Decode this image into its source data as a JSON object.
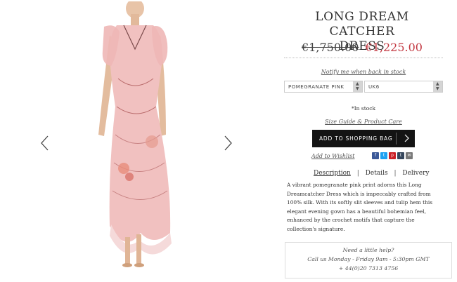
{
  "gallery": {
    "prev_icon": "chevron-left-icon",
    "next_icon": "chevron-right-icon"
  },
  "product": {
    "title_line1": "LONG DREAM CATCHER",
    "title_line2": "DRESS",
    "price_old": "€1,750.00",
    "price_new": "€1,225.00",
    "price_new_color": "#c33a43",
    "notify": "Notify me when back in stock",
    "color_select": "POMEGRANATE PINK",
    "size_select": "UK6",
    "stock": "*In stock",
    "size_guide": "Size Guide & Product Care",
    "add_to_bag": "ADD TO SHOPPING BAG",
    "wishlist": "Add to Wishlist"
  },
  "social": [
    {
      "icon": "facebook-icon",
      "glyph": "f",
      "color": "#3b5998"
    },
    {
      "icon": "twitter-icon",
      "glyph": "t",
      "color": "#1da1f2"
    },
    {
      "icon": "pinterest-icon",
      "glyph": "p",
      "color": "#cb2027"
    },
    {
      "icon": "tumblr-icon",
      "glyph": "t",
      "color": "#35465c"
    },
    {
      "icon": "email-icon",
      "glyph": "✉",
      "color": "#777777"
    }
  ],
  "tabs": [
    "Description",
    "Details",
    "Delivery"
  ],
  "description": "A vibrant pomegranate pink print adorns this Long Dreamcatcher Dress which is impeccably crafted from 100% silk. With its softly slit sleeves and tulip hem this elegant evening gown has a beautiful bohemian feel, enhanced by the crochet motifs that capture the collection's signature.",
  "help": {
    "heading": "Need a little help?",
    "hours": "Call us Monday - Friday 9am - 5:30pm GMT",
    "phone": "+ 44(0)20 7313 4756"
  }
}
